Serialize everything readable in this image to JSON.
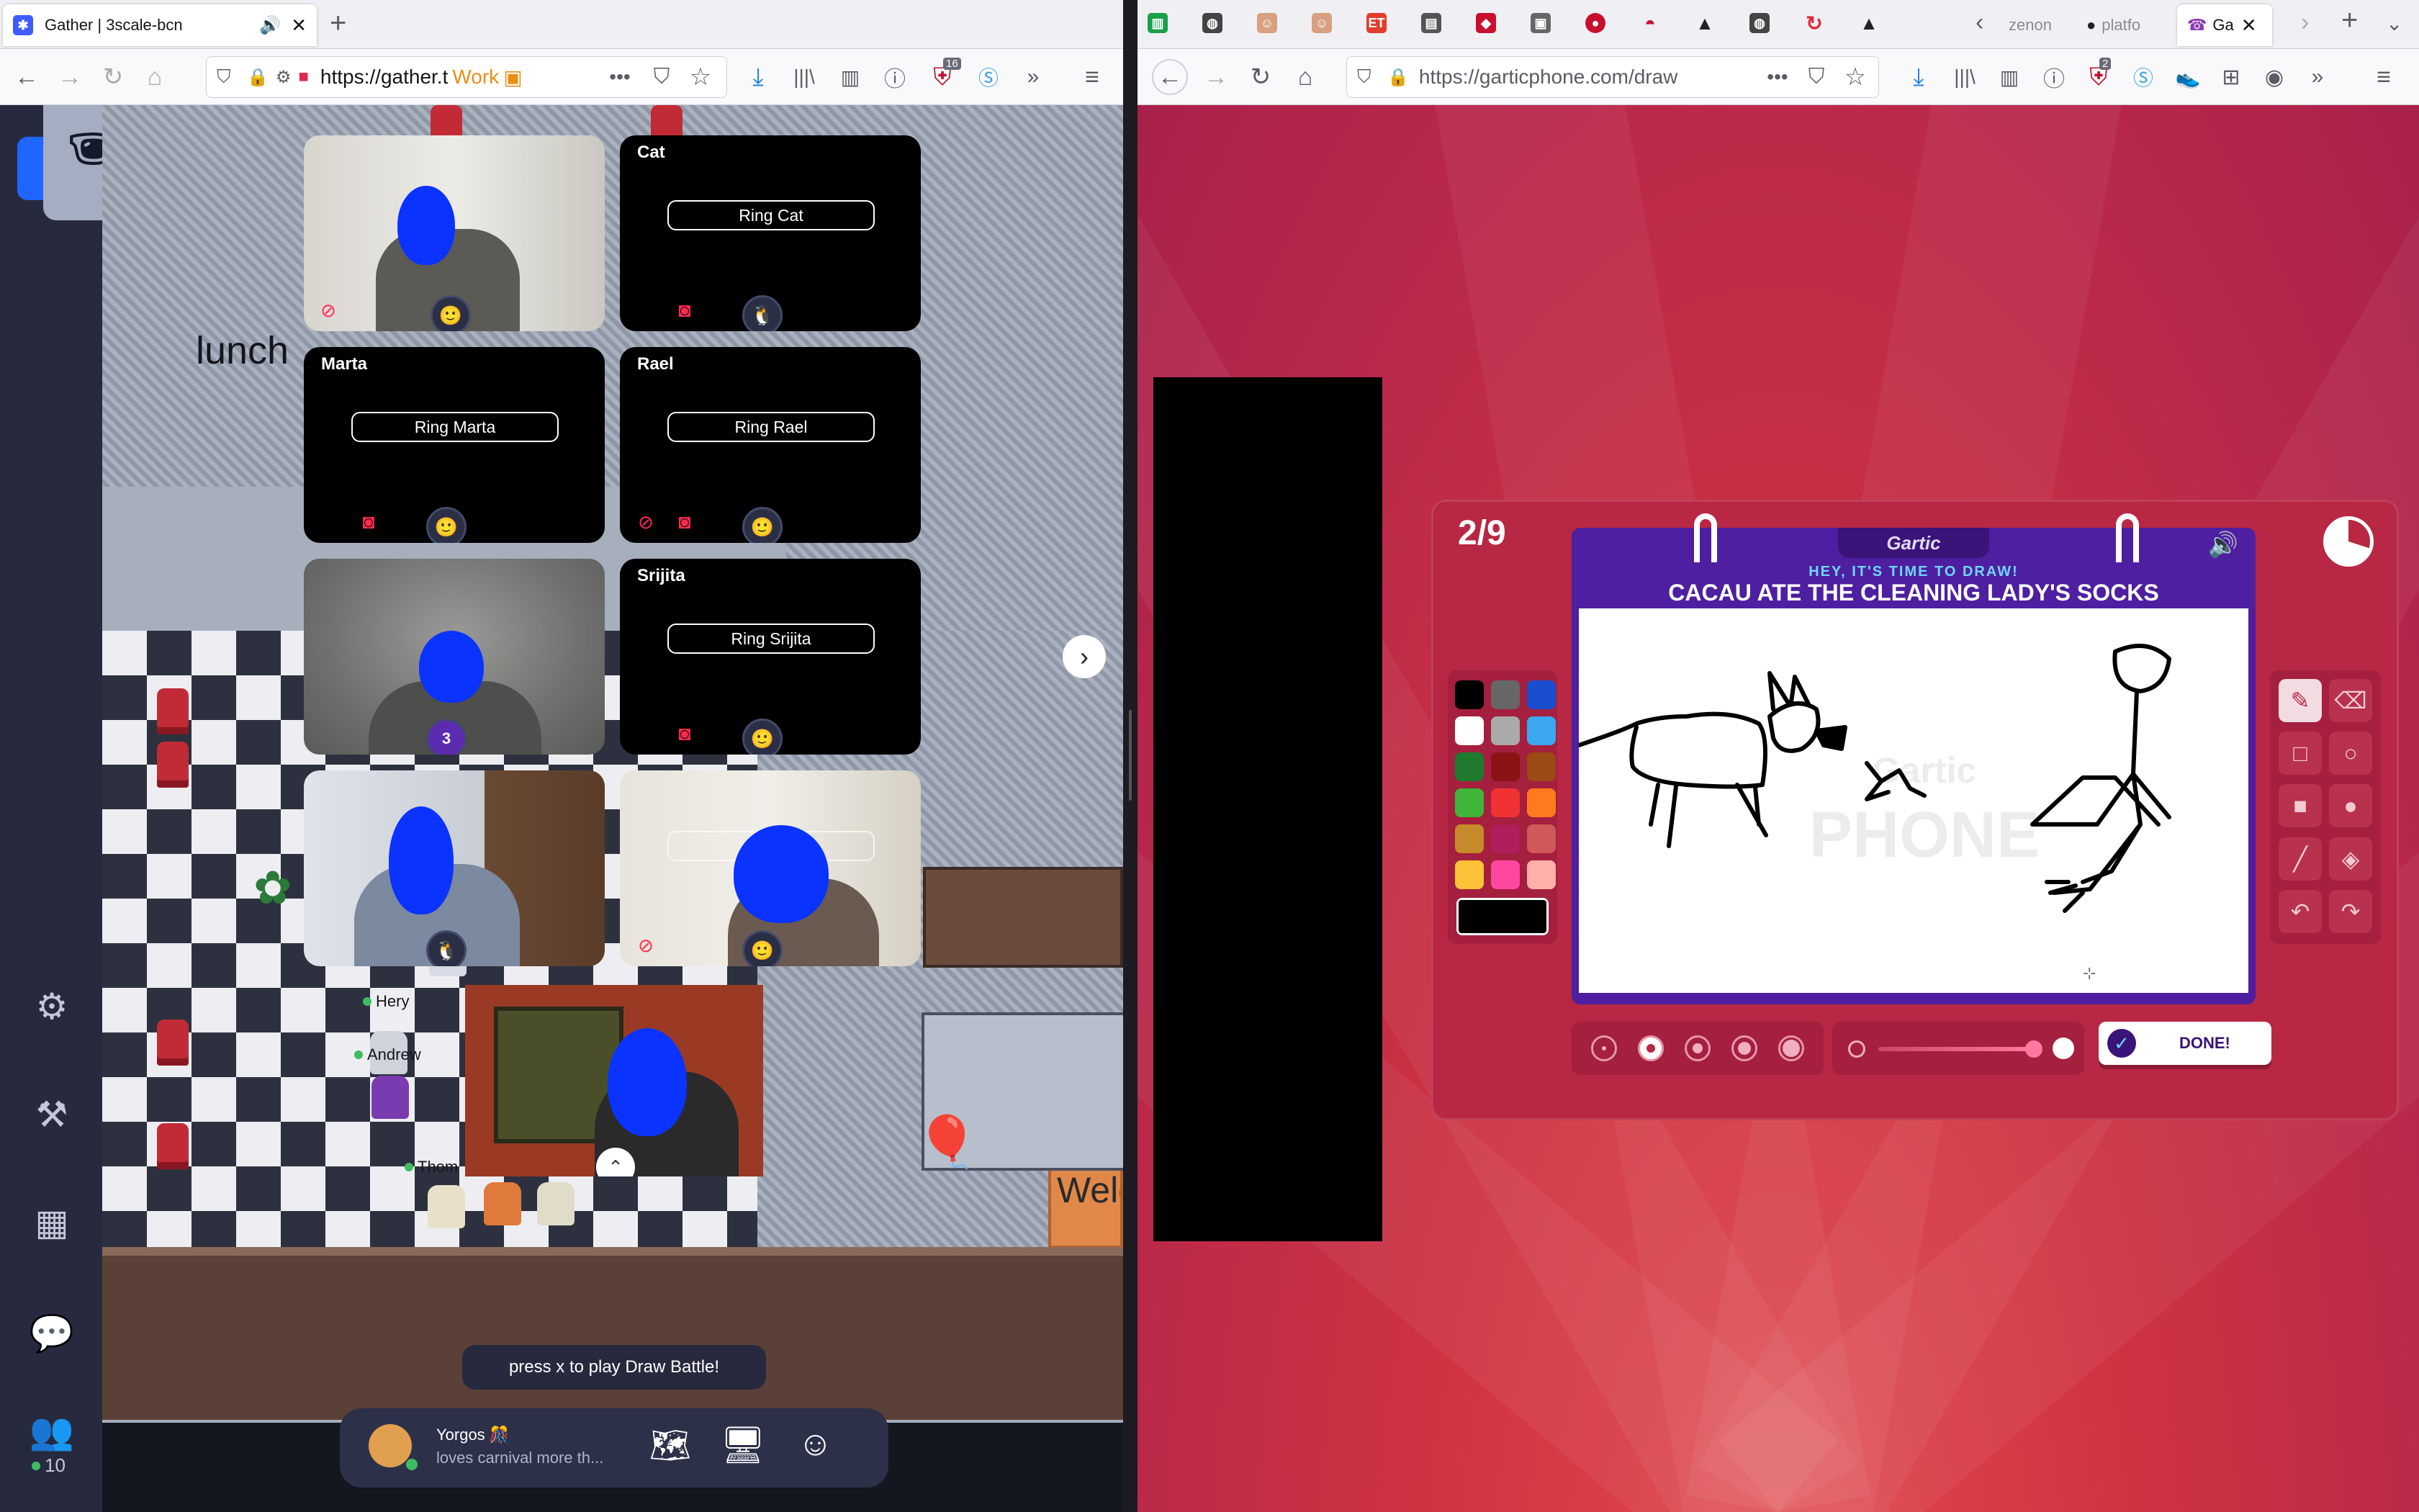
{
  "left": {
    "tabs": [
      {
        "title": "Gather | 3scale-bcn",
        "active": true
      }
    ],
    "new_tab": "+",
    "url": "https://gather.t",
    "container_label": "Work",
    "icons": [
      "back-icon",
      "forward-icon",
      "reload-icon",
      "home-icon",
      "shield-icon",
      "lock-icon",
      "permissions-icon",
      "camera-blocked-icon",
      "pocket-icon",
      "star-icon",
      "download-icon",
      "library-icon",
      "sidebar-icon",
      "onepassword-icon",
      "ublock-icon",
      "extension-s-icon",
      "overflow-icon",
      "menu-icon"
    ],
    "ublock_badge": "16",
    "incognito_badge": "incognito-icon",
    "gather": {
      "map_label_lunch": "lunch",
      "map_label_welcome": "Welc",
      "tiles": [
        {
          "name": "",
          "ring": "",
          "video": true
        },
        {
          "name": "Cat",
          "ring": "Ring Cat",
          "video": false
        },
        {
          "name": "Marta",
          "ring": "Ring Marta",
          "video": false
        },
        {
          "name": "Rael",
          "ring": "Ring Rael",
          "video": false
        },
        {
          "name": "",
          "ring": "",
          "video": true,
          "badge": "3"
        },
        {
          "name": "Srijita",
          "ring": "Ring Srijita",
          "video": false
        },
        {
          "name": "",
          "ring": "",
          "video": true
        },
        {
          "name": "",
          "ring": "Ri      ni",
          "video": true
        }
      ],
      "players": [
        "Hery",
        "Andrew",
        "Thom"
      ],
      "toast": "press x to play Draw Battle!",
      "user": {
        "name": "Yorgos 🎊",
        "status": "loves carnival more th..."
      },
      "bottom_icons": [
        "map-icon",
        "screen-share-icon",
        "emoji-icon"
      ],
      "sidebar_icons": [
        "settings-icon",
        "build-hammer-icon",
        "calendar-icon",
        "chat-icon",
        "participants-icon"
      ],
      "participants_count": "10"
    }
  },
  "right": {
    "url": "https://garticphone.com/draw",
    "tab_icons": [
      "trello-icon",
      "globe-icon",
      "avatar-icon",
      "avatar-icon",
      "rh-icon",
      "docs-icon",
      "redhat-icon",
      "app-icon",
      "redhat-icon",
      "redhat-hat-icon",
      "warning-icon",
      "globe-icon",
      "sync-icon",
      "warning-icon"
    ],
    "tabs_partial": [
      {
        "title": "zenon",
        "active": false
      },
      {
        "title": "platfo",
        "active": false
      },
      {
        "title": "Ga",
        "active": true
      }
    ],
    "ublock_badge": "2",
    "gartic": {
      "round": "2/9",
      "logo": "Gartic",
      "prompt_small": "HEY, IT'S TIME TO DRAW!",
      "prompt": "CACAU ATE THE CLEANING LADY'S SOCKS",
      "watermark_top": "Gartic",
      "watermark_bottom": "PHONE",
      "done_label": "DONE!",
      "palette": [
        "#000000",
        "#666666",
        "#1a4ed0",
        "#ffffff",
        "#aaaaaa",
        "#3aa7f0",
        "#1e7a2c",
        "#8a1414",
        "#9a4a14",
        "#3fb53a",
        "#f03232",
        "#ff7a1e",
        "#c78a2a",
        "#b01e5c",
        "#d0575a",
        "#fdc237",
        "#ff47a0",
        "#ffb0a8"
      ],
      "selected_color": "#000000",
      "tools": [
        "pencil-icon",
        "eraser-icon",
        "rectangle-outline-icon",
        "ellipse-outline-icon",
        "rectangle-fill-icon",
        "ellipse-fill-icon",
        "line-icon",
        "bucket-icon",
        "undo-icon",
        "redo-icon"
      ]
    }
  }
}
